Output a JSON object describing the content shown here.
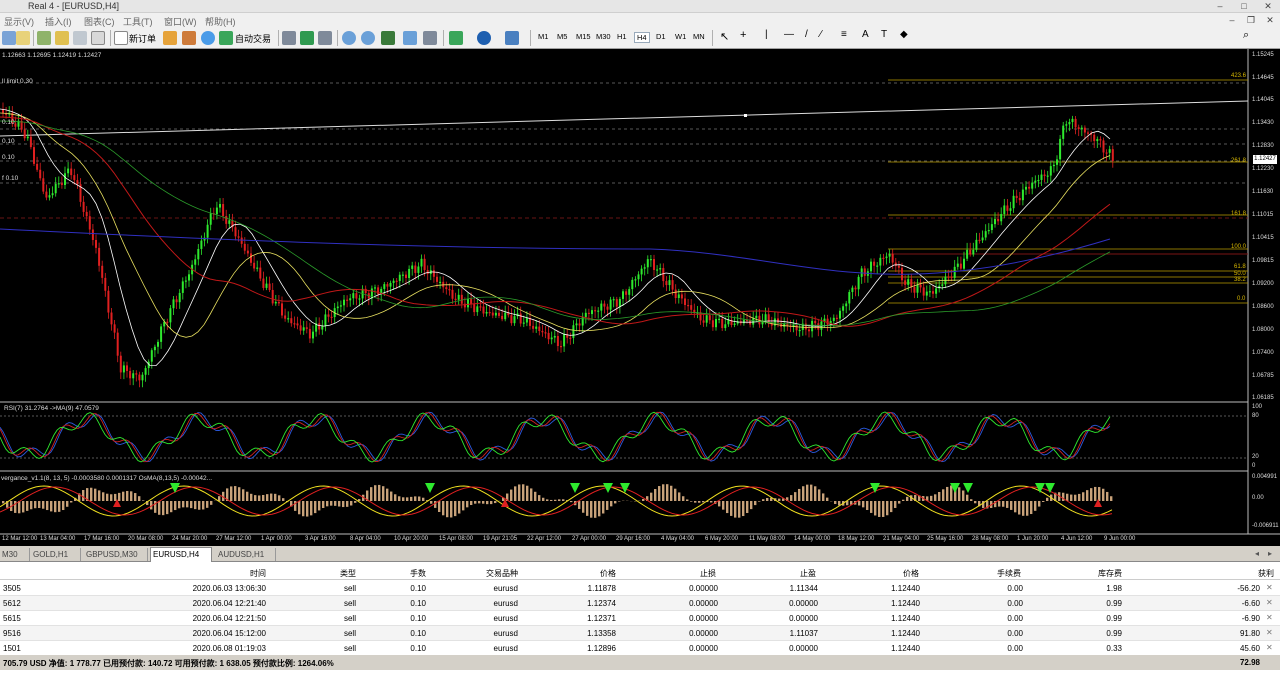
{
  "window": {
    "title": "Real 4 - [EURUSD,H4]"
  },
  "menu": [
    "显示(V)",
    "插入(I)",
    "图表(C)",
    "工具(T)",
    "窗口(W)",
    "帮助(H)"
  ],
  "toolbar": {
    "new_order": "新订单",
    "auto_trade": "自动交易",
    "timeframes": [
      "M1",
      "M5",
      "M15",
      "M30",
      "H1",
      "H4",
      "D1",
      "W1",
      "MN"
    ],
    "active_timeframe": "H4"
  },
  "chart": {
    "ohlc": "1.12663 1.12695 1.12419 1.12427",
    "left_labels": [
      "ll limit 0.30",
      "0.10",
      "0.10",
      "0.10",
      "f 0.10"
    ],
    "current_price": "1.12427",
    "price_ticks": [
      "1.15245",
      "1.14645",
      "1.14045",
      "1.13430",
      "1.12830",
      "1.12230",
      "1.11630",
      "1.11015",
      "1.10415",
      "1.09815",
      "1.09200",
      "1.08600",
      "1.08000",
      "1.07400",
      "1.06785",
      "1.06185"
    ],
    "fib_labels": [
      "423.6",
      "261.8",
      "161.8",
      "100.0",
      "61.8",
      "50.0",
      "38.2",
      "0.0"
    ],
    "time_ticks": [
      "12 Mar 12:00",
      "13 Mar 04:00",
      "17 Mar 16:00",
      "20 Mar 08:00",
      "24 Mar 20:00",
      "27 Mar 12:00",
      "1 Apr 00:00",
      "3 Apr 16:00",
      "8 Apr 04:00",
      "10 Apr 20:00",
      "15 Apr 08:00",
      "19 Apr 21:05",
      "22 Apr 12:00",
      "27 Apr 00:00",
      "29 Apr 16:00",
      "4 May 04:00",
      "6 May 20:00",
      "11 May 08:00",
      "14 May 00:00",
      "18 May 12:00",
      "21 May 04:00",
      "25 May 16:00",
      "28 May 08:00",
      "1 Jun 20:00",
      "4 Jun 12:00",
      "9 Jun 00:00"
    ],
    "rsi_label": "RSI(7) 31.2764  ->MA(9) 47.0579",
    "rsi_scale": [
      "100",
      "80",
      "20",
      "0"
    ],
    "osma_label": "vergance_v1.1(8, 13, 5) -0.0003580 0.0001317  OsMA(8,13,5) -0.00042...",
    "osma_scale": [
      "0.004991",
      "0.00",
      "-0.006911"
    ]
  },
  "tabs": [
    "M30",
    "GOLD,H1",
    "GBPUSD,M30",
    "EURUSD,H4",
    "AUDUSD,H1"
  ],
  "active_tab": "EURUSD,H4",
  "terminal": {
    "headers": [
      "时间",
      "类型",
      "手数",
      "交易品种",
      "价格",
      "止损",
      "止盈",
      "价格",
      "手续费",
      "库存费",
      "获利"
    ],
    "rows": [
      {
        "id": "3505",
        "time": "2020.06.03 13:06:30",
        "type": "sell",
        "lots": "0.10",
        "symbol": "eurusd",
        "open": "1.11878",
        "sl": "0.00000",
        "tp": "1.11344",
        "price": "1.12440",
        "commission": "0.00",
        "swap": "1.98",
        "profit": "-56.20"
      },
      {
        "id": "5612",
        "time": "2020.06.04 12:21:40",
        "type": "sell",
        "lots": "0.10",
        "symbol": "eurusd",
        "open": "1.12374",
        "sl": "0.00000",
        "tp": "0.00000",
        "price": "1.12440",
        "commission": "0.00",
        "swap": "0.99",
        "profit": "-6.60"
      },
      {
        "id": "5615",
        "time": "2020.06.04 12:21:50",
        "type": "sell",
        "lots": "0.10",
        "symbol": "eurusd",
        "open": "1.12371",
        "sl": "0.00000",
        "tp": "0.00000",
        "price": "1.12440",
        "commission": "0.00",
        "swap": "0.99",
        "profit": "-6.90"
      },
      {
        "id": "9516",
        "time": "2020.06.04 15:12:00",
        "type": "sell",
        "lots": "0.10",
        "symbol": "eurusd",
        "open": "1.13358",
        "sl": "0.00000",
        "tp": "1.11037",
        "price": "1.12440",
        "commission": "0.00",
        "swap": "0.99",
        "profit": "91.80"
      },
      {
        "id": "1501",
        "time": "2020.06.08 01:19:03",
        "type": "sell",
        "lots": "0.10",
        "symbol": "eurusd",
        "open": "1.12896",
        "sl": "0.00000",
        "tp": "0.00000",
        "price": "1.12440",
        "commission": "0.00",
        "swap": "0.33",
        "profit": "45.60"
      }
    ],
    "summary": "705.79 USD  净值: 1 778.77  已用预付款: 140.72  可用预付款: 1 638.05  预付款比例: 1264.06%",
    "summary_total": "72.98"
  }
}
